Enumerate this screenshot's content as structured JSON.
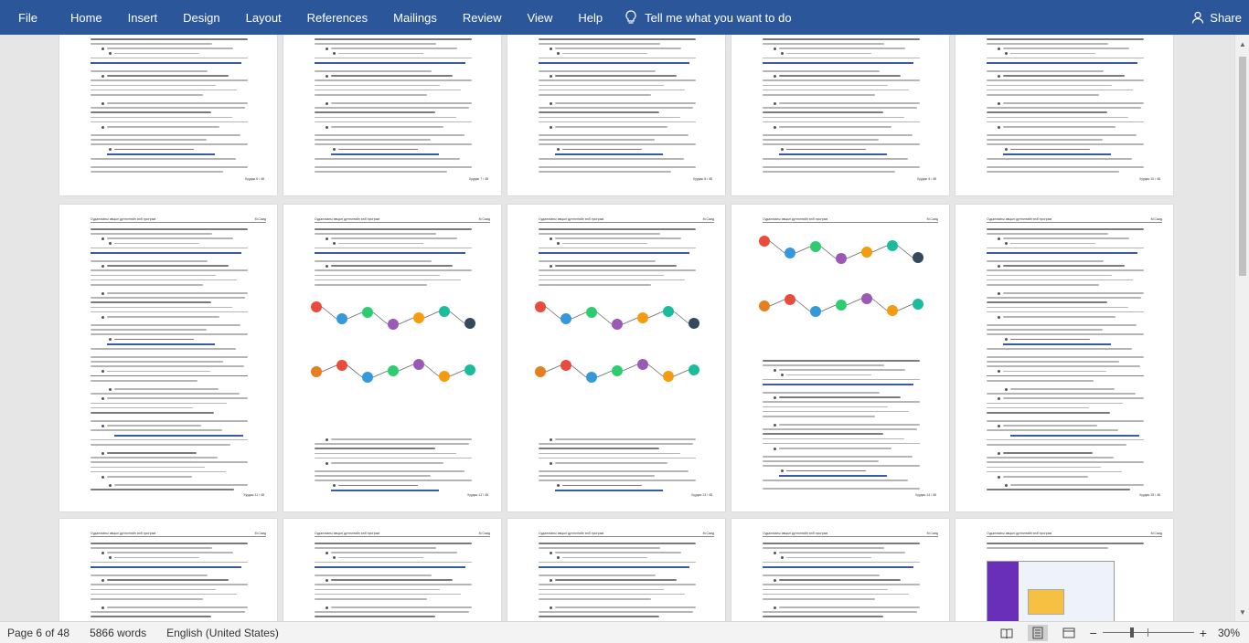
{
  "ribbon": {
    "file": "File",
    "tabs": [
      "Home",
      "Insert",
      "Design",
      "Layout",
      "References",
      "Mailings",
      "Review",
      "View",
      "Help"
    ],
    "tell_me": "Tell me what you want to do",
    "share": "Share",
    "accent": "#2b579a"
  },
  "pages": [
    {
      "header_left": "",
      "header_right": "",
      "number": "Хуудас 6 / 48"
    },
    {
      "header_left": "",
      "header_right": "",
      "number": "Хуудас 7 / 48"
    },
    {
      "header_left": "",
      "header_right": "",
      "number": "Хуудас 8 / 48"
    },
    {
      "header_left": "",
      "header_right": "",
      "number": "Хуудас 9 / 48"
    },
    {
      "header_left": "",
      "header_right": "",
      "number": "Хуудас 10 / 48"
    },
    {
      "header_left": "Судалгааны явцын дүгнэлтийн вэб програм",
      "header_right": "М.Саид",
      "number": "Хуудас 11 / 48"
    },
    {
      "header_left": "Судалгааны явцын дүгнэлтийн вэб програм",
      "header_right": "М.Саид",
      "number": "Хуудас 12 / 48"
    },
    {
      "header_left": "Судалгааны явцын дүгнэлтийн вэб програм",
      "header_right": "М.Саид",
      "number": "Хуудас 13 / 48"
    },
    {
      "header_left": "Судалгааны явцын дүгнэлтийн вэб програм",
      "header_right": "М.Саид",
      "number": "Хуудас 14 / 48"
    },
    {
      "header_left": "Судалгааны явцын дүгнэлтийн вэб програм",
      "header_right": "М.Саид",
      "number": "Хуудас 15 / 48"
    },
    {
      "header_left": "Судалгааны явцын дүгнэлтийн вэб програм",
      "header_right": "М.Саид",
      "number": ""
    },
    {
      "header_left": "Судалгааны явцын дүгнэлтийн вэб програм",
      "header_right": "М.Саид",
      "number": ""
    },
    {
      "header_left": "Судалгааны явцын дүгнэлтийн вэб програм",
      "header_right": "М.Саид",
      "number": ""
    },
    {
      "header_left": "Судалгааны явцын дүгнэлтийн вэб програм",
      "header_right": "М.Саид",
      "number": ""
    },
    {
      "header_left": "Судалгааны явцын дүгнэлтийн вэб програм",
      "header_right": "М.Саид",
      "number": ""
    }
  ],
  "status": {
    "page": "Page 6 of 48",
    "words": "5866 words",
    "language": "English (United States)",
    "zoom": "30%"
  }
}
